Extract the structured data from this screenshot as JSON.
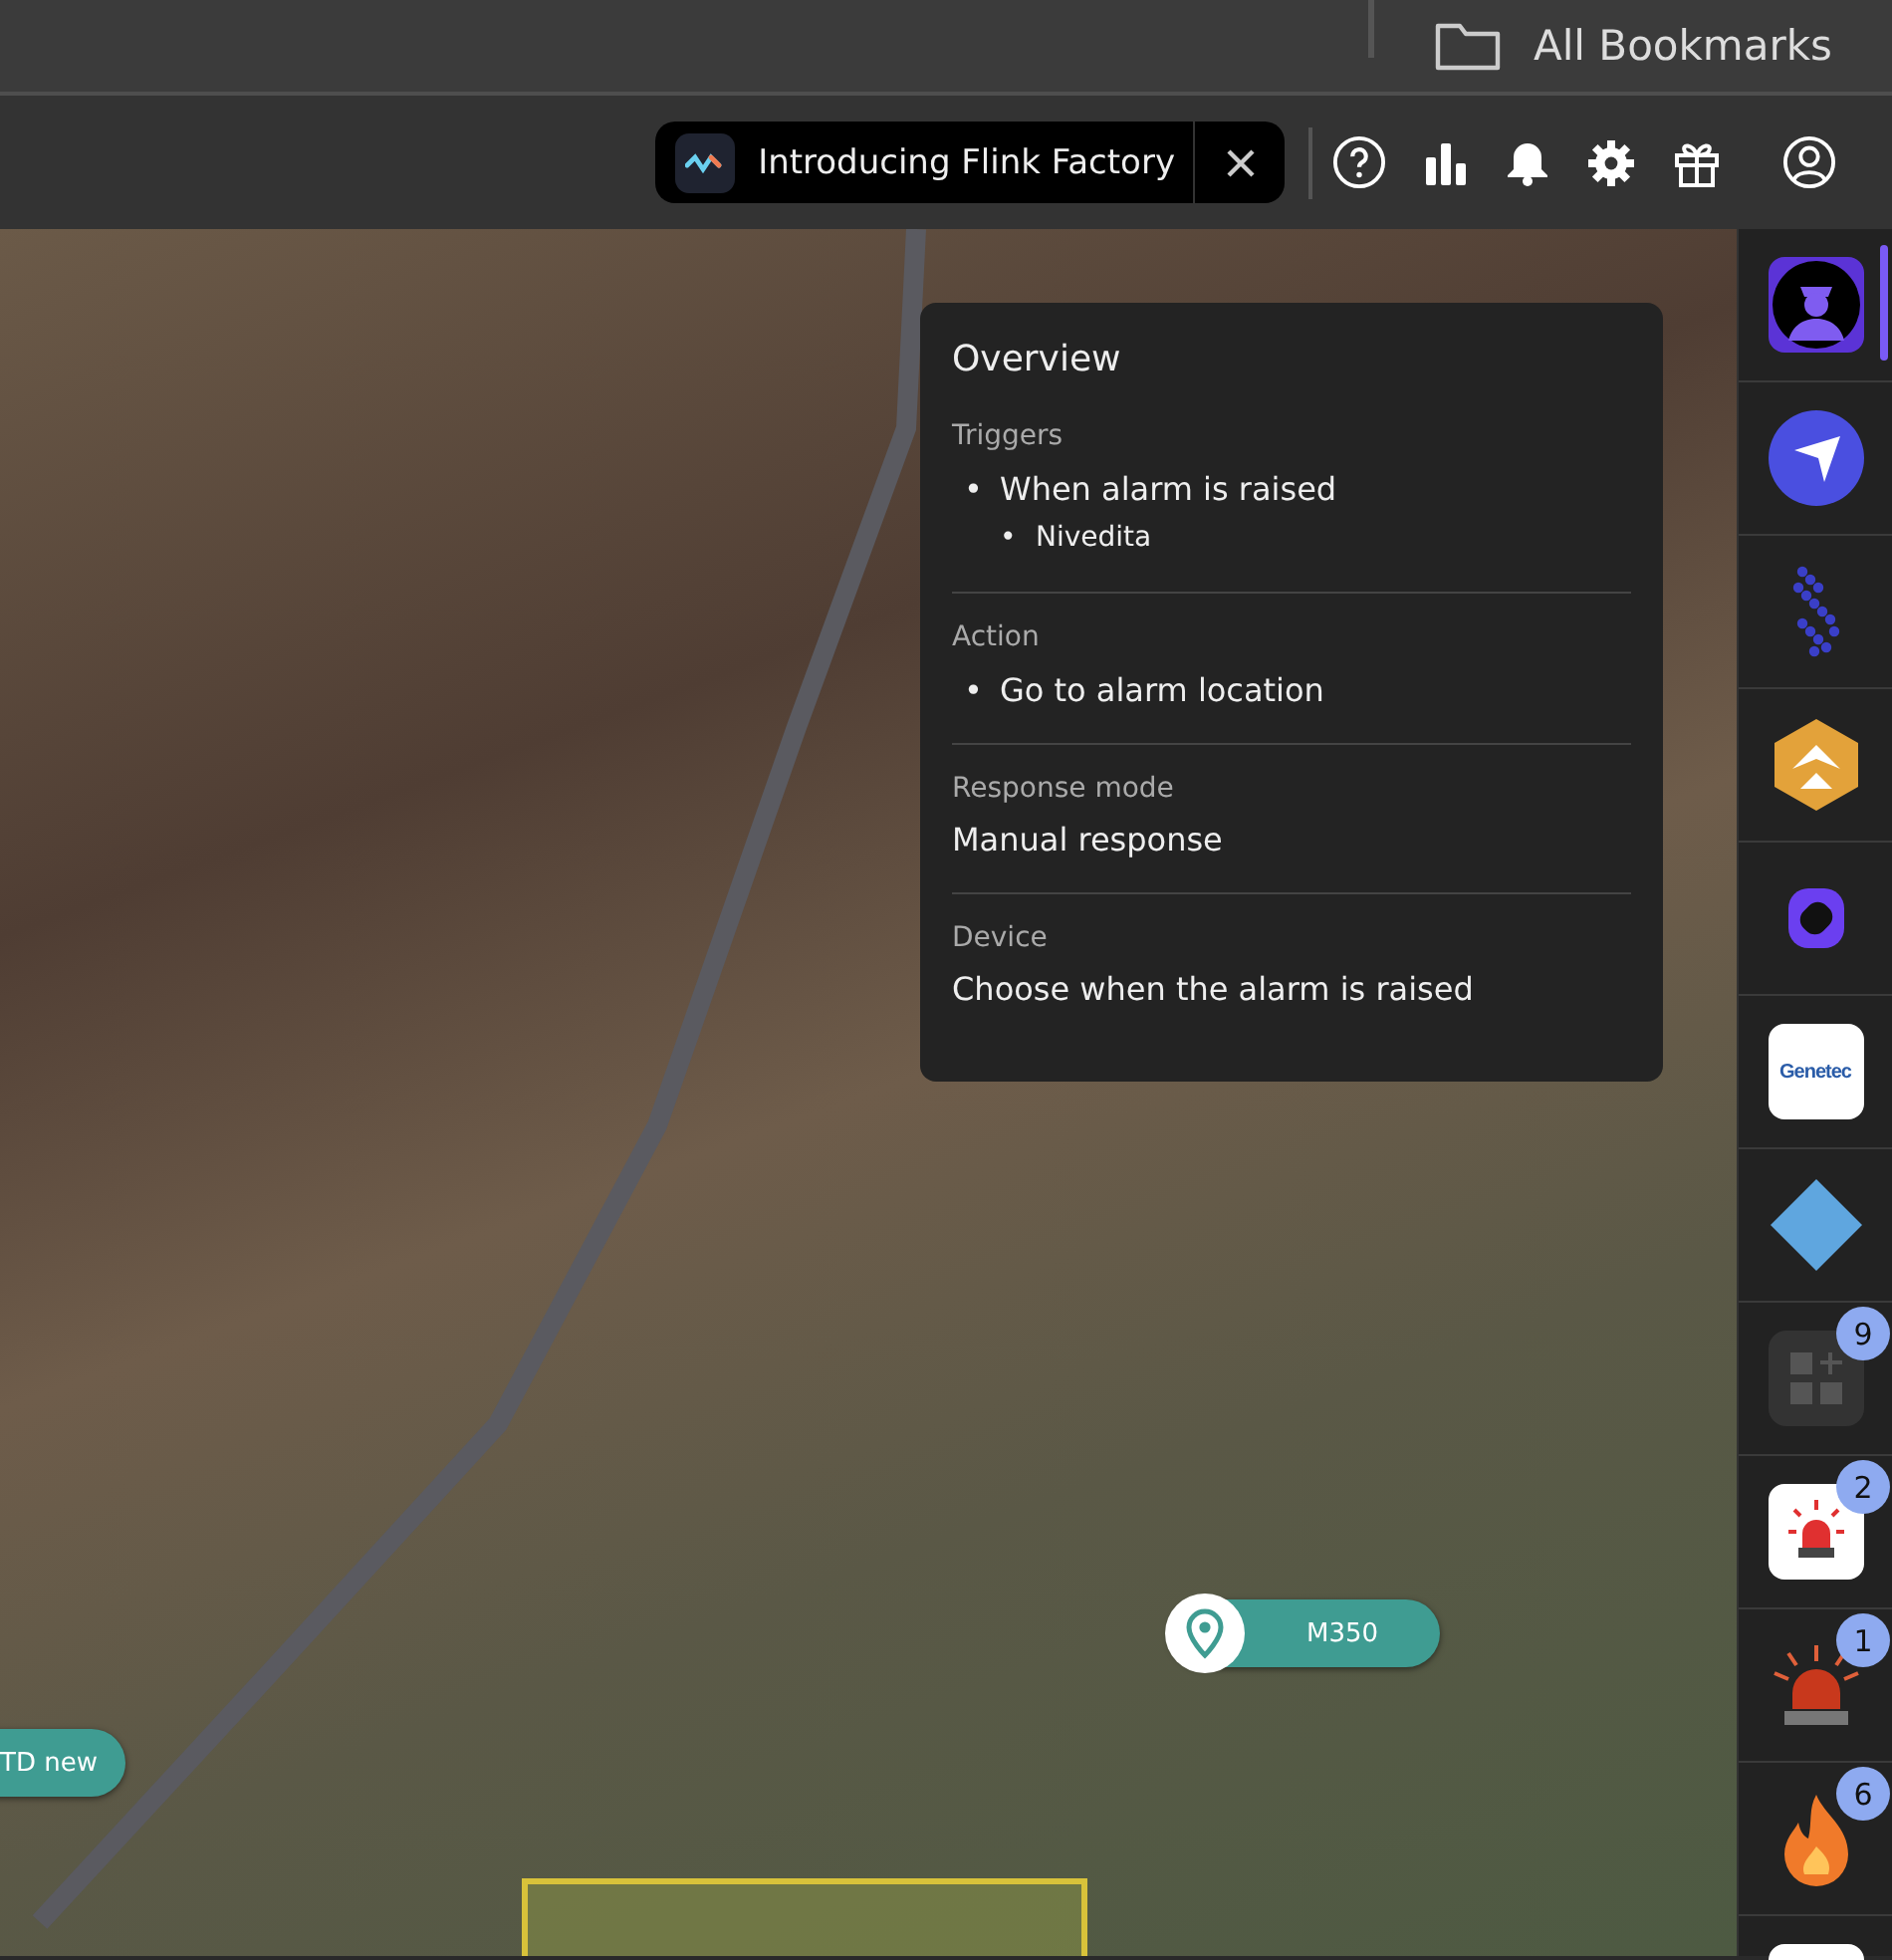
{
  "top_bar": {
    "bookmarks_label": "All Bookmarks"
  },
  "toolbar": {
    "announcement": {
      "text": "Introducing Flink Factory"
    }
  },
  "overview": {
    "title": "Overview",
    "sections": [
      {
        "label": "Triggers",
        "kind": "bullets",
        "items": [
          {
            "bullet": "•",
            "text": "When alarm is raised",
            "children": [
              {
                "bullet": "•",
                "text": "Nivedita"
              }
            ]
          }
        ]
      },
      {
        "label": "Action",
        "kind": "bullets",
        "items": [
          {
            "bullet": "•",
            "text": "Go to alarm location"
          }
        ]
      },
      {
        "label": "Response mode",
        "kind": "plain",
        "value": "Manual response"
      },
      {
        "label": "Device",
        "kind": "plain",
        "value": "Choose when the alarm is raised"
      }
    ]
  },
  "map": {
    "markers": [
      {
        "label": "M350",
        "kind": "pin"
      },
      {
        "label": "TD new",
        "kind": "plain"
      }
    ]
  },
  "rail": {
    "items": [
      {
        "kind": "police",
        "selected": true
      },
      {
        "kind": "navigation",
        "selected": false
      },
      {
        "kind": "dots",
        "selected": false
      },
      {
        "kind": "hexagon",
        "selected": false
      },
      {
        "kind": "ring",
        "selected": false
      },
      {
        "kind": "wordmark",
        "label": "Genetec",
        "selected": false
      },
      {
        "kind": "diamond",
        "selected": false
      },
      {
        "kind": "grid",
        "badge": "9",
        "selected": false
      },
      {
        "kind": "siren-tile",
        "badge": "2",
        "selected": false
      },
      {
        "kind": "siren",
        "badge": "1",
        "selected": false
      },
      {
        "kind": "fire",
        "badge": "6",
        "selected": false
      },
      {
        "kind": "tile",
        "selected": false
      }
    ]
  }
}
